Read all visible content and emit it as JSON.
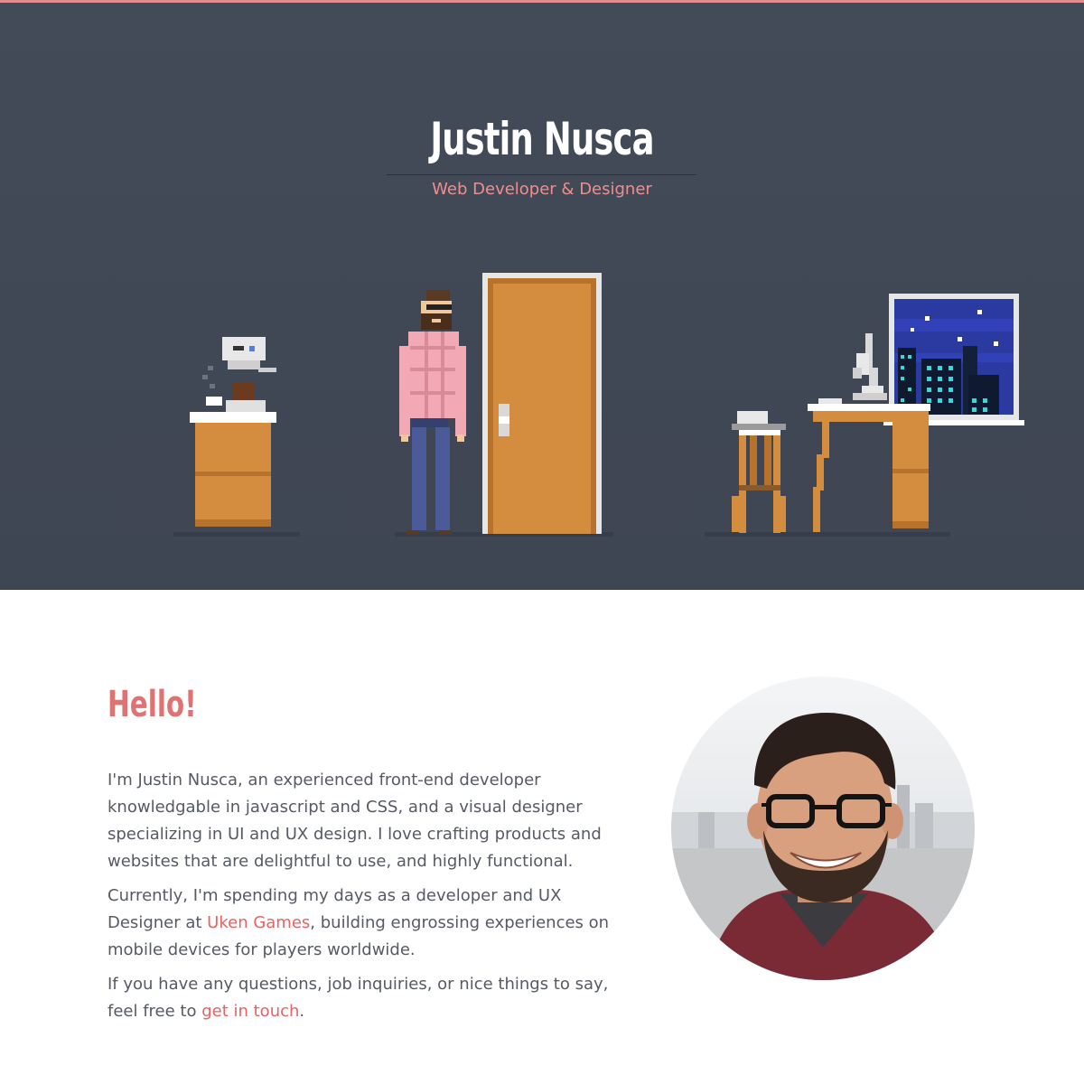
{
  "header": {
    "name": "Justin Nusca",
    "tagline": "Web Developer & Designer"
  },
  "about": {
    "heading": "Hello!",
    "p1": "I'm Justin Nusca, an experienced front-end developer knowledgable in javascript and CSS, and a visual designer specializing in UI and UX design. I love crafting products and websites that are delightful to use, and highly functional.",
    "p2_before": "Currently, I'm spending my days as a developer and UX Designer at ",
    "p2_link": "Uken Games",
    "p2_after": ", building engrossing experiences on mobile devices for players worldwide.",
    "p3_before": "If you have any questions, job inquiries, or nice things to say, feel free to ",
    "p3_link": "get in touch",
    "p3_after": "."
  },
  "colors": {
    "accent": "#e86262",
    "hero_bg": "#424a58",
    "wood": "#d48c3e"
  },
  "icons": [
    "coffee-machine-icon",
    "pixel-person-icon",
    "door-icon",
    "stool-icon",
    "desk-icon",
    "desk-lamp-icon",
    "night-window-icon"
  ]
}
